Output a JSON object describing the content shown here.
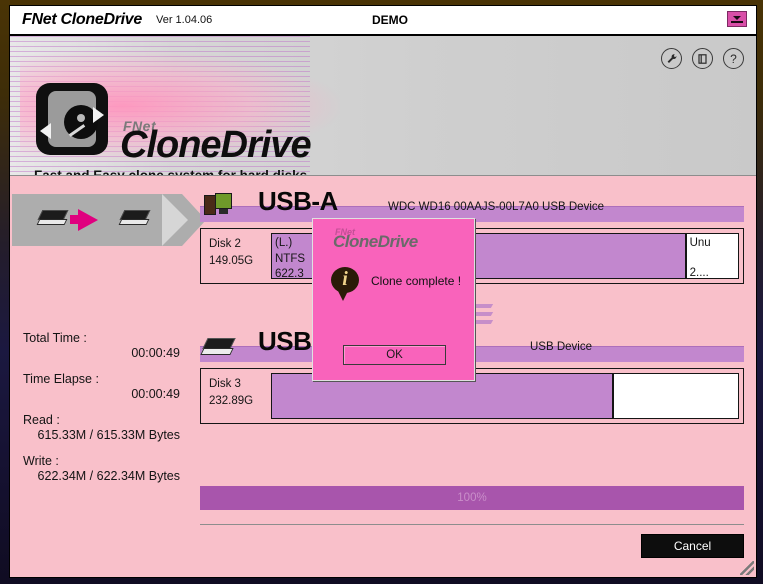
{
  "titlebar": {
    "app_name": "FNet CloneDrive",
    "version": "Ver 1.04.06",
    "mode": "DEMO",
    "minimize_label": "minimize"
  },
  "banner": {
    "brand_prefix": "FNet",
    "brand_name": "CloneDrive",
    "tagline": "Fast and Easy clone system for hard disks",
    "tools": [
      {
        "name": "settings-icon",
        "glyph": "ὒ7"
      },
      {
        "name": "manual-icon",
        "glyph": "▤"
      },
      {
        "name": "help-icon",
        "glyph": "?"
      }
    ]
  },
  "stats": {
    "total_time_label": "Total Time :",
    "total_time_value": "00:00:49",
    "time_elapse_label": "Time Elapse :",
    "time_elapse_value": "00:00:49",
    "read_label": "Read :",
    "read_value": "615.33M / 615.33M Bytes",
    "write_label": "Write :",
    "write_value": "622.34M / 622.34M Bytes"
  },
  "groups": [
    {
      "title": "USB-A",
      "model": "WDC WD16 00AAJS-00L7A0 USB Device",
      "disk_name": "Disk 2",
      "disk_size": "149.05G",
      "partitions": [
        {
          "letter": "(L.)",
          "fs": "NTFS",
          "size": "622.3",
          "type": "used",
          "width_pct": 11
        },
        {
          "letter": "",
          "fs": "",
          "size": "",
          "type": "used",
          "width_pct": 74
        },
        {
          "letter": "Unu",
          "fs": "",
          "size": "2....",
          "type": "unused",
          "width_pct": 10
        }
      ]
    },
    {
      "title": "USB-B",
      "model": "USB Device",
      "disk_name": "Disk 3",
      "disk_size": "232.89G",
      "partitions": [
        {
          "letter": "",
          "fs": "",
          "size": "",
          "type": "used",
          "width_pct": 64
        },
        {
          "letter": "",
          "fs": "",
          "size": "",
          "type": "unused",
          "width_pct": 35
        }
      ]
    }
  ],
  "progress": {
    "percent_label": "100%",
    "percent_value": 100
  },
  "footer": {
    "cancel_label": "Cancel"
  },
  "modal": {
    "brand_prefix": "FNet",
    "brand_name": "CloneDrive",
    "message": "Clone complete !",
    "ok_label": "OK"
  },
  "colors": {
    "page_bg": "#f9c0ca",
    "accent_purple": "#c287ce",
    "progress_purple": "#a855ac",
    "modal_pink": "#f963bb",
    "arrow_magenta": "#e0007f"
  }
}
